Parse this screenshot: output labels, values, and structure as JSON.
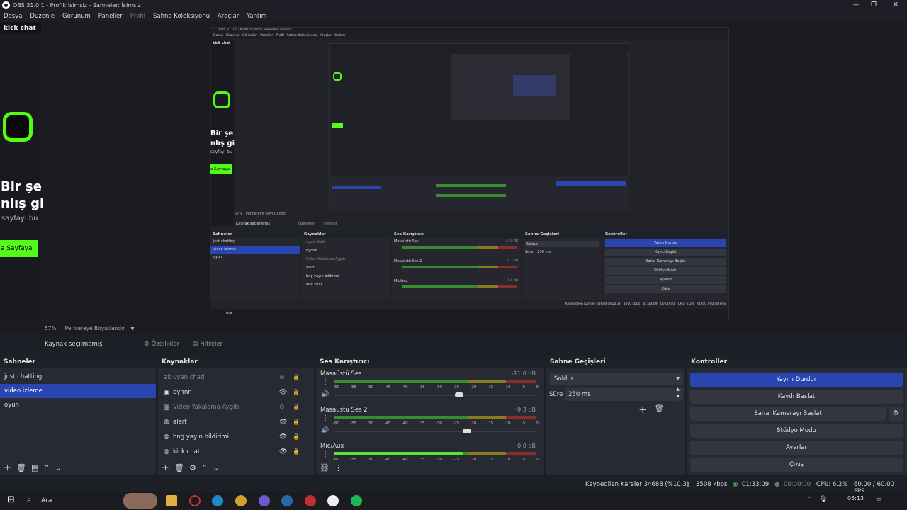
{
  "window": {
    "title": "OBS 31.0.1 - Profil: İsimsiz - Sahneler: İsimsiz",
    "minimize": "—",
    "maximize": "❐",
    "close": "✕"
  },
  "menu": [
    {
      "label": "Dosya"
    },
    {
      "label": "Düzenle"
    },
    {
      "label": "Görünüm"
    },
    {
      "label": "Paneller"
    },
    {
      "label": "Profil",
      "disabled": true
    },
    {
      "label": "Sahne Koleksiyonu"
    },
    {
      "label": "Araçlar"
    },
    {
      "label": "Yardım"
    }
  ],
  "preview": {
    "kick_chat": "kick chat",
    "promo_line1": "Bir şe",
    "promo_line2": "nlış gi",
    "promo_line3": "sayfayı bu",
    "promo_button": "a Sayfaya",
    "nested_title": "OBS 31.0.1 - Profil: İsimsiz - Sahneler: İsimsiz",
    "nested_menu": "Dosya   Düzenle   Görünüm   Paneller   Profil   Sahne Koleksiyonu   Araçlar   Yardım",
    "nested_kick": "kick chat",
    "nested_l1": "Bir şe",
    "nested_l2": "nlış gi",
    "nested_l3": "sayfayı bu",
    "nested_btn": "a Sayfaya",
    "nested_scale": "57%   Pencereye Boyutlandır",
    "nested_nosource": "Kaynak seçilmemiş",
    "nested_props": "Özellikler",
    "nested_filters": "Filtreler",
    "nested_scenes_h": "Sahneler",
    "nested_sources_h": "Kaynaklar",
    "nested_mixer_h": "Ses Karıştırıcı",
    "nested_trans_h": "Sahne Geçişleri",
    "nested_controls_h": "Kontroller",
    "nested_scenes": [
      "just chatting",
      "video izleme",
      "oyun"
    ],
    "nested_sources": [
      "uyan chati",
      "bynnn",
      "Video Yakalama Aygıtı",
      "alert",
      "bng yayın bildirimi",
      "kick chat"
    ],
    "nested_mix": [
      "Masaüstü Ses",
      "Masaüstü Ses 2",
      "Mic/Aux"
    ],
    "nested_mix_db": [
      "-11.0 dB",
      "-9.3 dB",
      "0.0 dB"
    ],
    "nested_trans": "Soldur",
    "nested_dur_l": "Süre",
    "nested_dur": "250 ms",
    "nested_controls": [
      "Yayını Durdur",
      "Kaydı Başlat",
      "Sanal Kamerayı Başlat",
      "Stüdyo Modu",
      "Ayarlar",
      "Çıkış"
    ],
    "nested_status": "Kaybedilen Kareler 34688 (%10.3)   3500 kbps   01:33:09   00:00:00   CPU: 6.2%   60.00 / 60.00 FPS",
    "nested_search": "Ara"
  },
  "scale_bar": {
    "zoom": "57%",
    "mode": "Pencereye Boyutlandır"
  },
  "selection": {
    "no_source": "Kaynak seçilmemiş",
    "properties": "Özellikler",
    "filters": "Filtreler"
  },
  "scenes": {
    "title": "Sahneler",
    "items": [
      {
        "label": "just chatting"
      },
      {
        "label": "video izleme",
        "selected": true
      },
      {
        "label": "oyun"
      }
    ]
  },
  "sources": {
    "title": "Kaynaklar",
    "items": [
      {
        "label": "uyan chati",
        "icon": "text-icon",
        "visible": false
      },
      {
        "label": "bynnn",
        "icon": "image-icon",
        "visible": true
      },
      {
        "label": "Video Yakalama Aygıtı",
        "icon": "camera-icon",
        "visible": false
      },
      {
        "label": "alert",
        "icon": "globe-icon",
        "visible": true
      },
      {
        "label": "bng yayın bildirimi",
        "icon": "globe-icon",
        "visible": true
      },
      {
        "label": "kick chat",
        "icon": "globe-icon",
        "visible": true
      }
    ]
  },
  "mixer": {
    "title": "Ses Karıştırıcı",
    "ticks": [
      "-60",
      "-55",
      "-50",
      "-45",
      "-40",
      "-35",
      "-30",
      "-25",
      "-20",
      "-15",
      "-10",
      "-5",
      "0"
    ],
    "channels": [
      {
        "name": "Masaüstü Ses",
        "db": "-11.0 dB",
        "level": 0,
        "volume": 0.62
      },
      {
        "name": "Masaüstü Ses 2",
        "db": "-9.3 dB",
        "level": 0,
        "volume": 0.66
      },
      {
        "name": "Mic/Aux",
        "db": "0.0 dB",
        "level": 0.64,
        "volume": null
      }
    ]
  },
  "transitions": {
    "title": "Sahne Geçişleri",
    "type": "Soldur",
    "duration_label": "Süre",
    "duration": "250 ms"
  },
  "controls": {
    "title": "Kontroller",
    "buttons": [
      {
        "label": "Yayını Durdur",
        "active": true
      },
      {
        "label": "Kaydı Başlat"
      },
      {
        "label": "Sanal Kamerayı Başlat",
        "gear": true
      },
      {
        "label": "Stüdyo Modu"
      },
      {
        "label": "Ayarlar"
      },
      {
        "label": "Çıkış"
      }
    ]
  },
  "status": {
    "dropped": "Kaybedilen Kareler 34688 (%10.3)",
    "bitrate": "3508 kbps",
    "stream_time": "01:33:09",
    "rec_time": "00:00:00",
    "cpu": "CPU: 6.2%",
    "fps": "60.00 / 60.00 FPS"
  },
  "taskbar": {
    "search": "Ara",
    "time": "05:13"
  },
  "colors": {
    "accent": "#2945b0",
    "kick_green": "#53fc18",
    "panel": "#272a33",
    "header": "#1f2129"
  }
}
